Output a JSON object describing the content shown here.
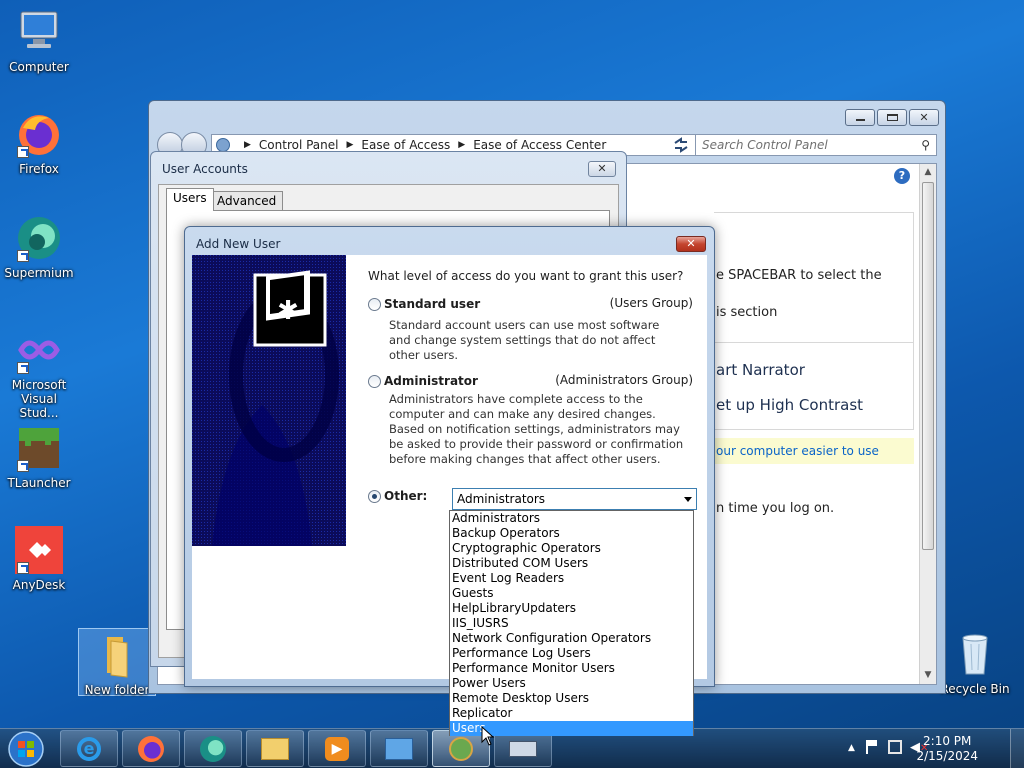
{
  "desktop": {
    "icons": [
      {
        "label": "Computer",
        "icon": "computer-icon"
      },
      {
        "label": "Firefox",
        "icon": "firefox-icon"
      },
      {
        "label": "Supermium",
        "icon": "supermium-icon"
      },
      {
        "label": "Microsoft Visual Stud...",
        "icon": "visual-studio-icon"
      },
      {
        "label": "TLauncher",
        "icon": "minecraft-icon"
      },
      {
        "label": "AnyDesk",
        "icon": "anydesk-icon"
      },
      {
        "label": "New folder",
        "icon": "folder-icon"
      },
      {
        "label": "Recycle Bin",
        "icon": "recycle-bin-icon"
      }
    ]
  },
  "control_panel": {
    "breadcrumb": [
      "Control Panel",
      "Ease of Access",
      "Ease of Access Center"
    ],
    "search_placeholder": "Search Control Panel",
    "content": {
      "line1": "e SPACEBAR to select the",
      "line2": "is section",
      "narrator": "art Narrator",
      "high_contrast": "et up High Contrast",
      "link": "our computer easier to use",
      "logon": "n time you log on."
    }
  },
  "user_accounts": {
    "title": "User Accounts",
    "tabs": [
      "Users",
      "Advanced"
    ],
    "close_label": "✕"
  },
  "add_new_user": {
    "title": "Add New User",
    "close_label": "✕",
    "question": "What level of access do you want to grant this user?",
    "options": [
      {
        "label": "Standard user",
        "group": "(Users Group)",
        "description": "Standard account users can use most software and change system settings that do not affect other users."
      },
      {
        "label": "Administrator",
        "group": "(Administrators Group)",
        "description": "Administrators have complete access to the computer and can make any desired changes. Based on notification settings, administrators may be asked to provide their password or confirmation before making changes that affect other users."
      }
    ],
    "other_label": "Other:",
    "selected_option": "Other",
    "other_select_value": "Administrators",
    "dropdown_items": [
      "Administrators",
      "Backup Operators",
      "Cryptographic Operators",
      "Distributed COM Users",
      "Event Log Readers",
      "Guests",
      "HelpLibraryUpdaters",
      "IIS_IUSRS",
      "Network Configuration Operators",
      "Performance Log Users",
      "Performance Monitor Users",
      "Power Users",
      "Remote Desktop Users",
      "Replicator",
      "Users"
    ],
    "highlighted_item": "Users"
  },
  "taskbar": {
    "apps": [
      "internet-explorer-icon",
      "firefox-icon",
      "supermium-icon",
      "file-explorer-icon",
      "media-player-icon",
      "control-panel-icon",
      "user-accounts-icon",
      "on-screen-keyboard-icon"
    ],
    "clock_time": "2:10 PM",
    "clock_date": "2/15/2024"
  },
  "colors": {
    "accent": "#3399ff",
    "close_red": "#c4452f"
  }
}
